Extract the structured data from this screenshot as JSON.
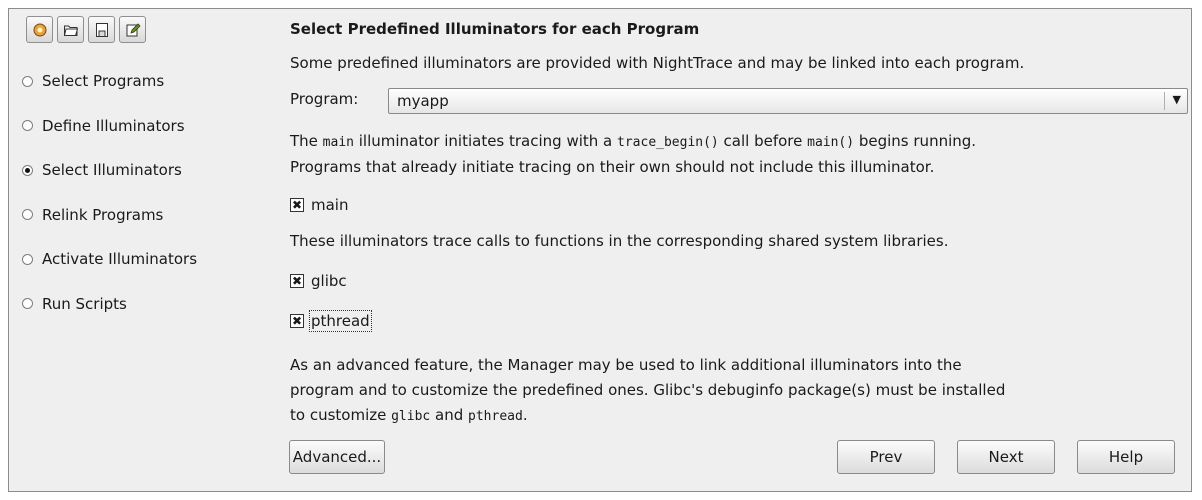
{
  "toolbar": {
    "icons": [
      "new-icon",
      "open-folder-icon",
      "save-icon",
      "edit-icon"
    ]
  },
  "steps": [
    {
      "label": "Select Programs",
      "checked": false
    },
    {
      "label": "Define Illuminators",
      "checked": false
    },
    {
      "label": "Select Illuminators",
      "checked": true
    },
    {
      "label": "Relink Programs",
      "checked": false
    },
    {
      "label": "Activate Illuminators",
      "checked": false
    },
    {
      "label": "Run Scripts",
      "checked": false
    }
  ],
  "panel": {
    "title": "Select Predefined Illuminators for each Program",
    "intro": "Some predefined illuminators are provided with NightTrace and may be linked into each program.",
    "program_label": "Program:",
    "program_value": "myapp",
    "main_desc": {
      "p1": "The ",
      "code1": "main",
      "p2": " illuminator initiates tracing with a ",
      "code2": "trace_begin()",
      "p3": " call before ",
      "code3": "main()",
      "p4": " begins running."
    },
    "main_desc_line2": "Programs that already initiate tracing on their own should not include this illuminator.",
    "main_checkbox": {
      "label": "main",
      "checked": true
    },
    "libs_desc": "These illuminators trace calls to functions in the corresponding shared system libraries.",
    "glibc_checkbox": {
      "label": "glibc",
      "checked": true
    },
    "pthread_checkbox": {
      "label": "pthread",
      "checked": true
    },
    "advanced_line1": "As an advanced feature, the Manager may be used to link additional illuminators into the",
    "advanced_line2": "program and to customize the predefined ones. Glibc's debuginfo package(s) must be installed",
    "advanced_line3": {
      "p1": "to customize ",
      "code1": "glibc",
      "p2": " and ",
      "code2": "pthread",
      "p3": "."
    }
  },
  "buttons": {
    "advanced": "Advanced...",
    "prev": "Prev",
    "next": "Next",
    "help": "Help"
  }
}
